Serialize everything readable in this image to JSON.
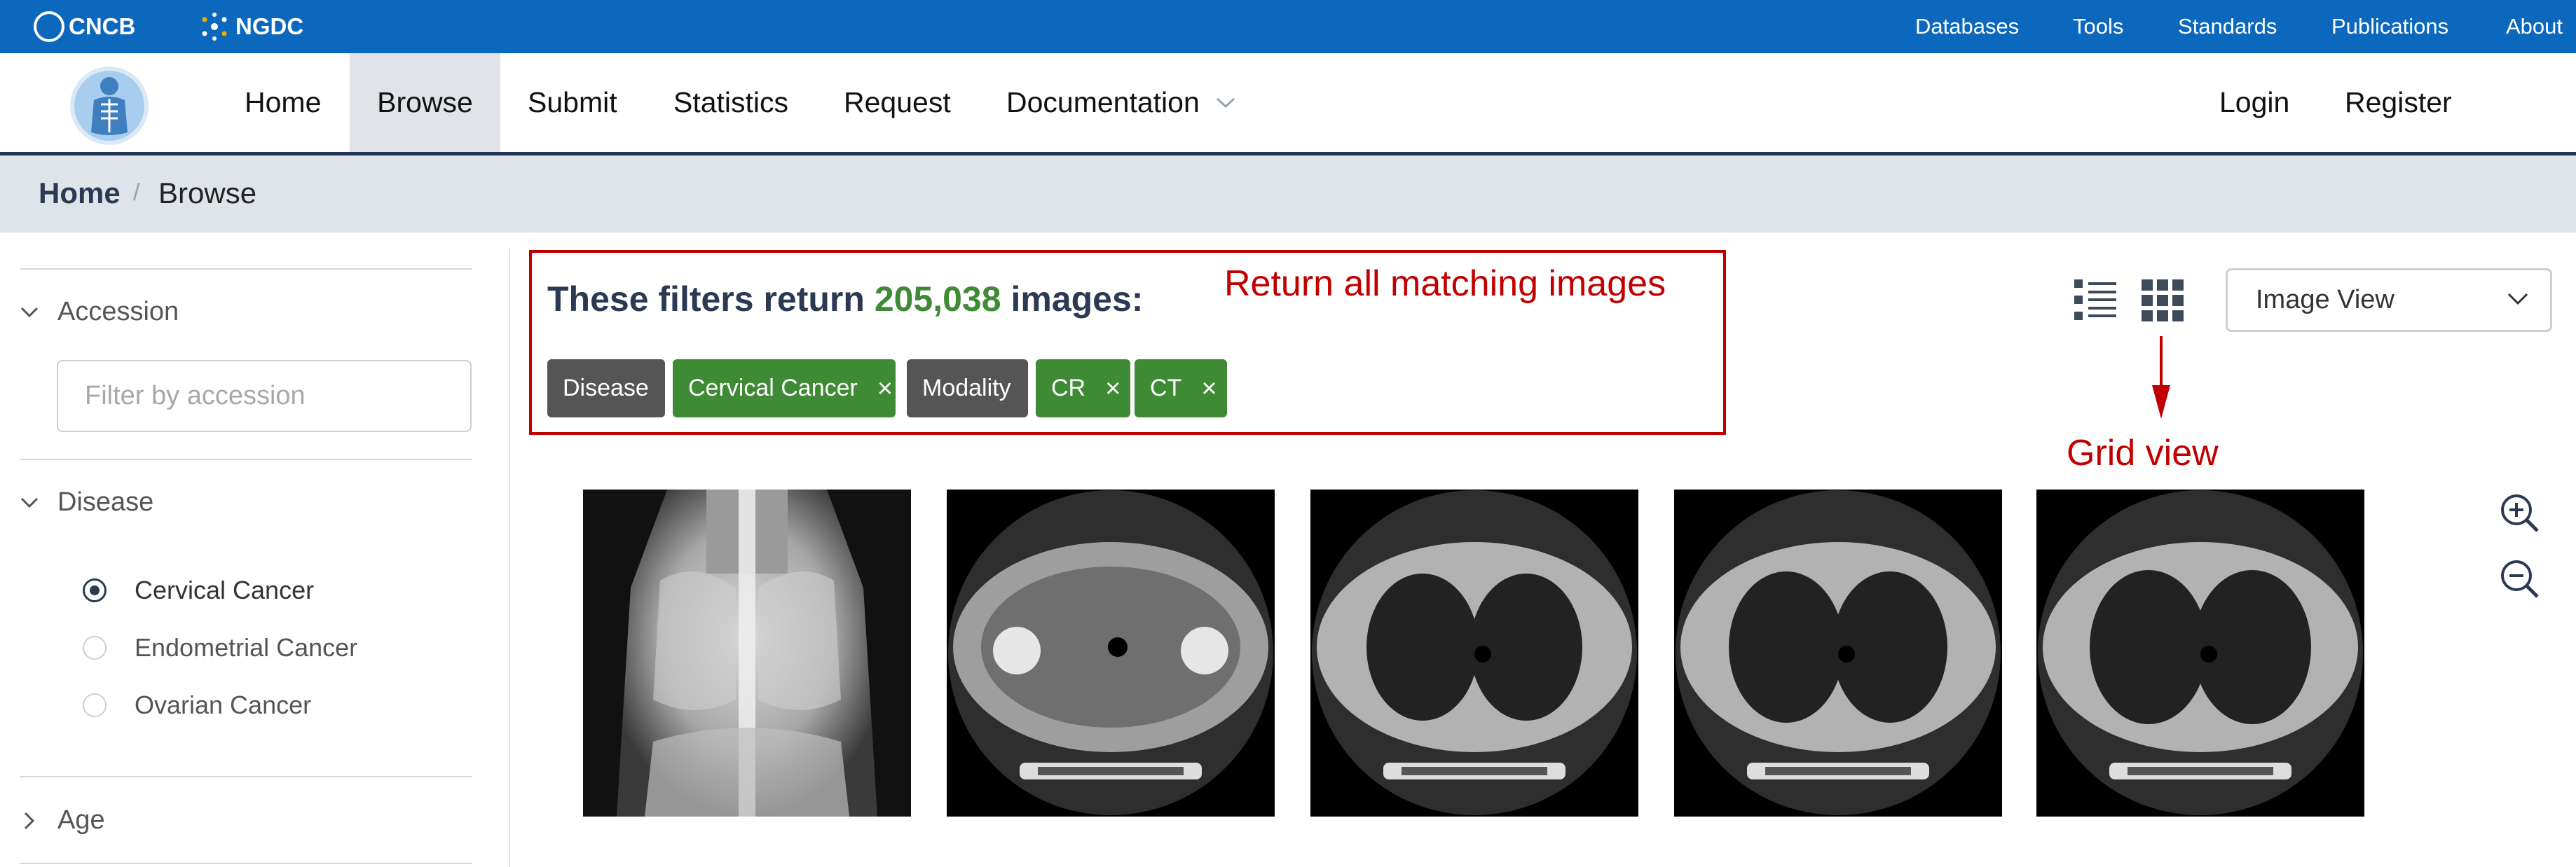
{
  "topbar": {
    "brand_cncb": "CNCB",
    "brand_ngdc": "NGDC",
    "links": [
      "Databases",
      "Tools",
      "Standards",
      "Publications",
      "About"
    ]
  },
  "nav": {
    "items": [
      "Home",
      "Browse",
      "Submit",
      "Statistics",
      "Request",
      "Documentation"
    ],
    "active": "Browse",
    "auth": [
      "Login",
      "Register"
    ]
  },
  "breadcrumb": {
    "home": "Home",
    "separator": "/",
    "current": "Browse"
  },
  "sidebar": {
    "accession": {
      "title": "Accession",
      "placeholder": "Filter by accession"
    },
    "disease": {
      "title": "Disease",
      "options": [
        "Cervical Cancer",
        "Endometrial Cancer",
        "Ovarian Cancer"
      ],
      "selected": "Cervical Cancer"
    },
    "age": {
      "title": "Age"
    }
  },
  "results": {
    "prefix": "These filters return",
    "count": "205,038",
    "suffix": "images:",
    "tags": [
      {
        "label": "Disease",
        "kind": "category"
      },
      {
        "label": "Cervical Cancer",
        "kind": "value",
        "remove": "×"
      },
      {
        "label": "Modality",
        "kind": "category"
      },
      {
        "label": "CR",
        "kind": "value",
        "remove": "×"
      },
      {
        "label": "CT",
        "kind": "value",
        "remove": "×"
      }
    ]
  },
  "annotations": {
    "matching": "Return all matching images",
    "grid": "Grid view"
  },
  "view": {
    "selected": "Image View"
  },
  "colors": {
    "topbar": "#0b68bd",
    "count_green": "#3f8a35",
    "tag_gray": "#555555",
    "tag_green": "#3f8a35",
    "annotation_red": "#c00000",
    "heading": "#2b3a52"
  },
  "icons": [
    "cncb-logo-icon",
    "ngdc-logo-icon",
    "site-logo-icon",
    "chevron-down-icon",
    "chevron-right-icon",
    "list-view-icon",
    "grid-view-icon",
    "zoom-in-icon",
    "zoom-out-icon"
  ]
}
